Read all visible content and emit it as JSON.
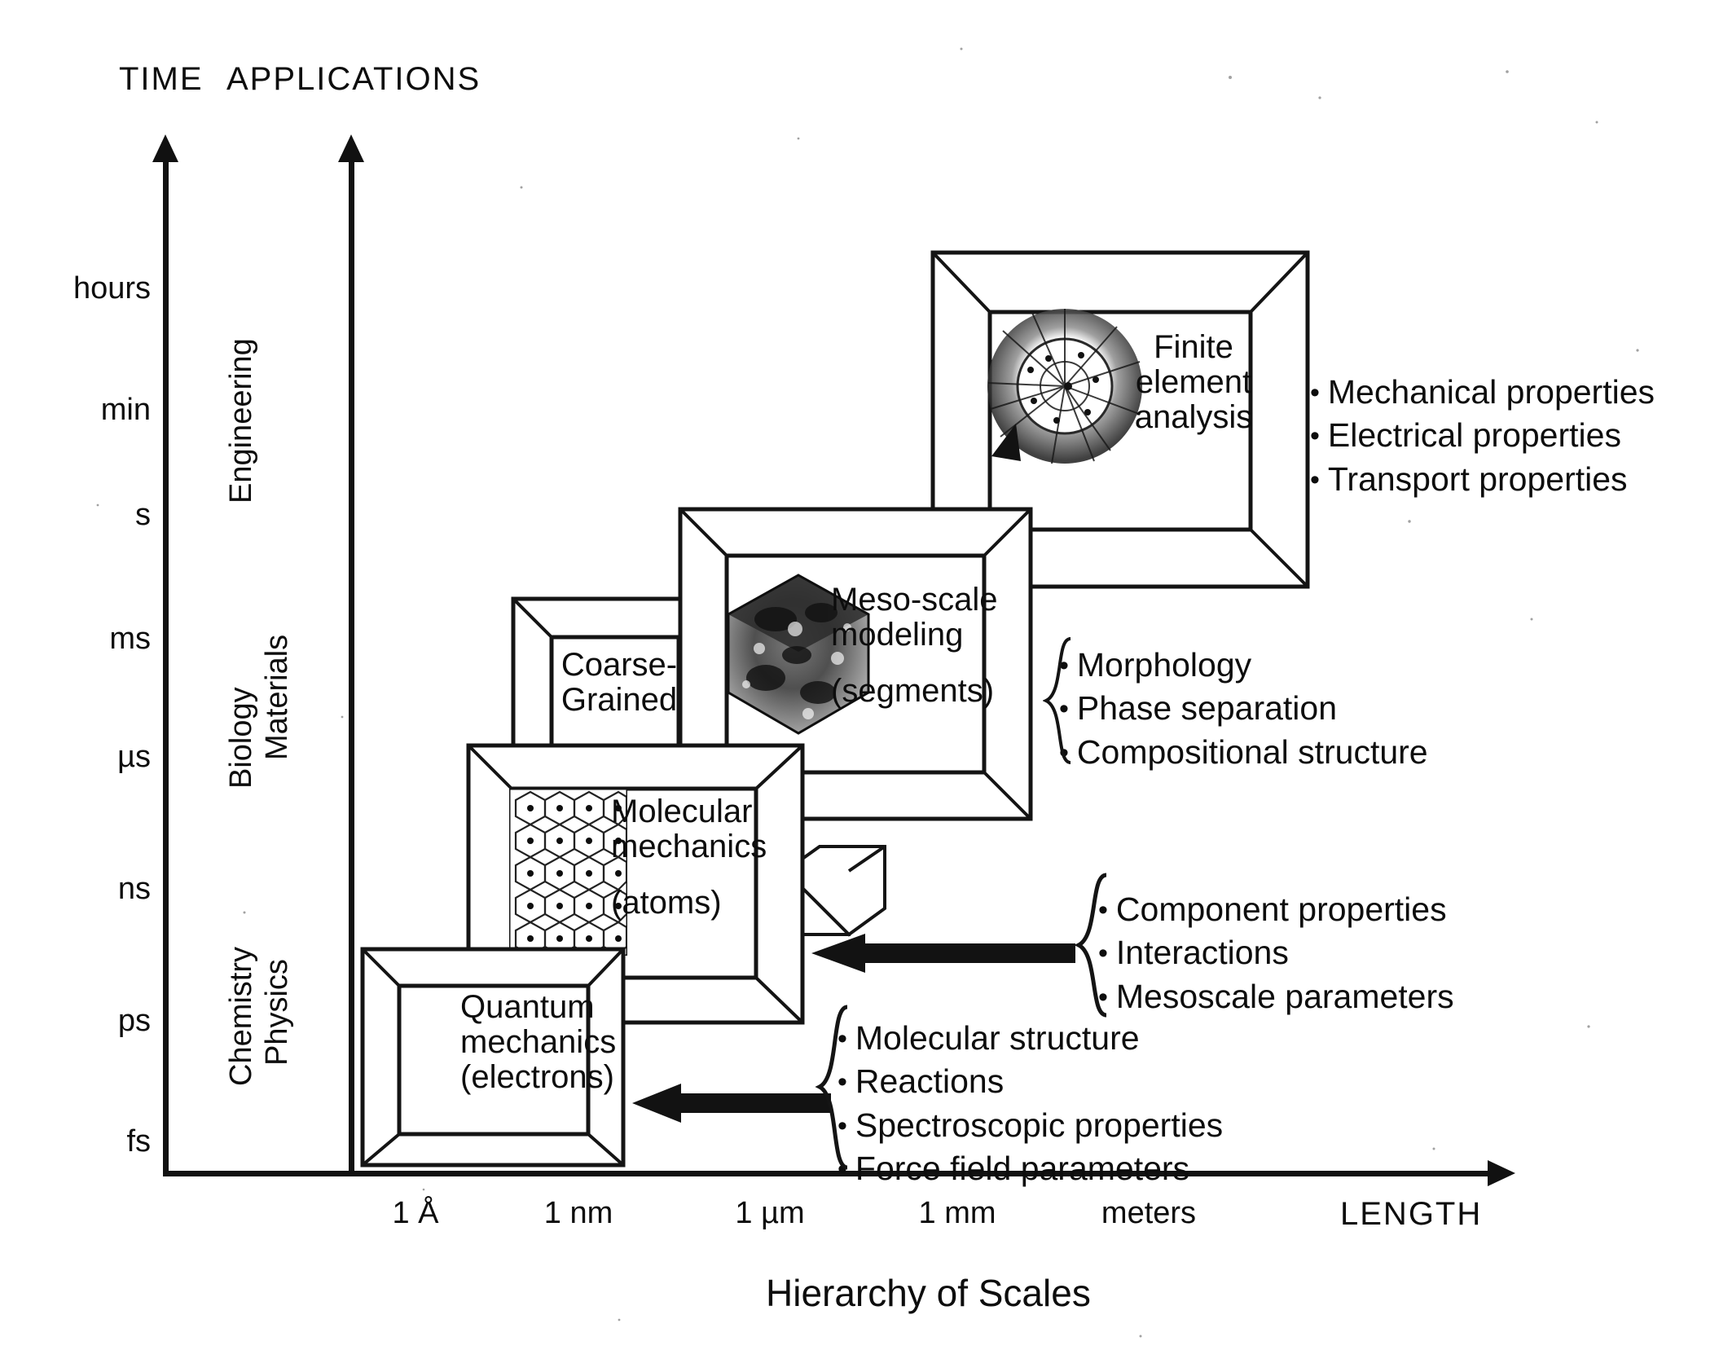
{
  "figure": {
    "caption": "Hierarchy of Scales",
    "time_axis_title": "TIME",
    "applications_axis_title": "APPLICATIONS",
    "length_axis_title": "LENGTH"
  },
  "chart_data": {
    "type": "diagram",
    "title": "Hierarchy of Scales",
    "xlabel": "LENGTH",
    "ylabel": "TIME",
    "grid": false,
    "legend": "none",
    "x_ticks": [
      "1 Å",
      "1 nm",
      "1 µm",
      "1 mm",
      "meters"
    ],
    "y_ticks": [
      "fs",
      "ps",
      "ns",
      "µs",
      "ms",
      "s",
      "min",
      "hours"
    ],
    "application_bands": [
      "Physics",
      "Chemistry",
      "Biology",
      "Materials",
      "Engineering"
    ],
    "stages": [
      {
        "name": "quantum-mechanics",
        "title_lines": [
          "Quantum",
          "mechanics"
        ],
        "subtitle": "(electrons)",
        "x_range": [
          "1 Å",
          "1 nm"
        ],
        "y_range": [
          "fs",
          "ps"
        ]
      },
      {
        "name": "molecular-mechanics",
        "title_lines": [
          "Molecular",
          "mechanics"
        ],
        "subtitle": "(atoms)",
        "x_range": [
          "1 nm",
          "1 µm"
        ],
        "y_range": [
          "ps",
          "µs"
        ]
      },
      {
        "name": "coarse-grained",
        "title_lines": [
          "Coarse-",
          "Grained"
        ],
        "subtitle": "",
        "x_range": [
          "1 nm",
          "1 µm"
        ],
        "y_range": [
          "µs",
          "ms"
        ]
      },
      {
        "name": "meso-scale-modeling",
        "title_lines": [
          "Meso-scale",
          "modeling"
        ],
        "subtitle": "(segments)",
        "x_range": [
          "1 µm",
          "1 mm"
        ],
        "y_range": [
          "ns",
          "s"
        ]
      },
      {
        "name": "finite-element-analysis",
        "title_lines": [
          "Finite",
          "element",
          "analysis"
        ],
        "subtitle": "",
        "x_range": [
          "1 mm",
          "meters"
        ],
        "y_range": [
          "s",
          "hours"
        ]
      }
    ],
    "annotation_groups": [
      {
        "name": "engineering-properties",
        "items": [
          "Mechanical properties",
          "Electrical properties",
          "Transport properties"
        ]
      },
      {
        "name": "mesoscale-outputs",
        "items": [
          "Morphology",
          "Phase separation",
          "Compositional structure"
        ]
      },
      {
        "name": "molecular-to-mesoscale-inputs",
        "items": [
          "Component properties",
          "Interactions",
          "Mesoscale parameters"
        ]
      },
      {
        "name": "quantum-to-molecular-inputs",
        "items": [
          "Molecular structure",
          "Reactions",
          "Spectroscopic properties",
          "Force field parameters"
        ]
      }
    ]
  },
  "time_axis": {
    "title": "TIME",
    "ticks": [
      {
        "label": "hours"
      },
      {
        "label": "min"
      },
      {
        "label": "s"
      },
      {
        "label": "ms"
      },
      {
        "label": "µs"
      },
      {
        "label": "ns"
      },
      {
        "label": "ps"
      },
      {
        "label": "fs"
      }
    ]
  },
  "applications_axis": {
    "title": "APPLICATIONS",
    "bands": [
      {
        "label": "Engineering"
      },
      {
        "label": "Biology"
      },
      {
        "label": "Materials"
      },
      {
        "label": "Chemistry"
      },
      {
        "label": "Physics"
      }
    ]
  },
  "length_axis": {
    "title": "LENGTH",
    "ticks": [
      {
        "label": "1 Å"
      },
      {
        "label": "1 nm"
      },
      {
        "label": "1 µm"
      },
      {
        "label": "1 mm"
      },
      {
        "label": "meters"
      }
    ]
  },
  "stages": {
    "quantum": {
      "line1": "Quantum",
      "line2": "mechanics",
      "line3": "(electrons)"
    },
    "molecular": {
      "line1": "Molecular",
      "line2": "mechanics",
      "line3": "(atoms)"
    },
    "coarse": {
      "line1": "Coarse-",
      "line2": "Grained"
    },
    "meso": {
      "line1": "Meso-scale",
      "line2": "modeling",
      "line3": "(segments)"
    },
    "fea": {
      "line1": "Finite",
      "line2": "element",
      "line3": "analysis"
    }
  },
  "annotations": {
    "engineering": {
      "b1": "Mechanical properties",
      "b2": "Electrical properties",
      "b3": "Transport properties"
    },
    "meso": {
      "b1": "Morphology",
      "b2": "Phase separation",
      "b3": "Compositional structure"
    },
    "component": {
      "b1": "Component properties",
      "b2": "Interactions",
      "b3": "Mesoscale parameters"
    },
    "molecular": {
      "b1": "Molecular structure",
      "b2": "Reactions",
      "b3": "Spectroscopic properties",
      "b4": "Force field parameters"
    }
  },
  "caption": "Hierarchy of Scales"
}
